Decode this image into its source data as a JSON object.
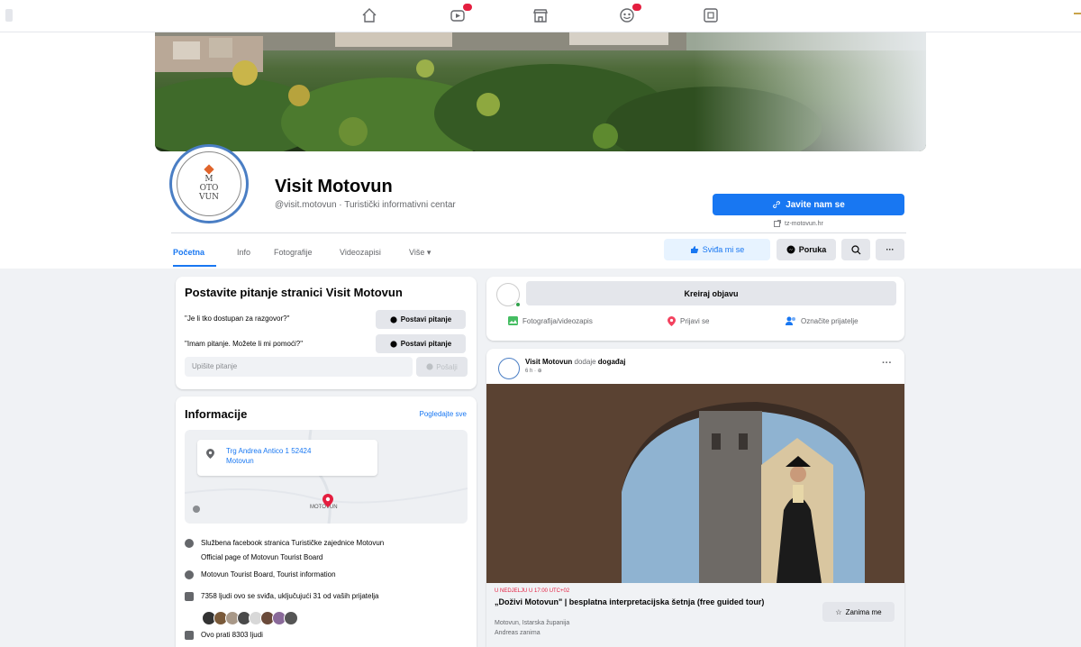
{
  "topnav": {
    "icons": [
      "home-icon",
      "watch-icon",
      "marketplace-icon",
      "groups-icon",
      "gaming-icon"
    ]
  },
  "page": {
    "name": "Visit Motovun",
    "handle": "@visit.motovun · Turistički informativni centar",
    "avatar_text_top": "M",
    "avatar_text_mid": "OTO",
    "avatar_text_bot": "VUN",
    "contact_button": "Javite nam se",
    "website": "tz-motovun.hr"
  },
  "tabs": [
    {
      "label": "Početna"
    },
    {
      "label": "Info"
    },
    {
      "label": "Fotografije"
    },
    {
      "label": "Videozapisi"
    },
    {
      "label": "Više ▾"
    }
  ],
  "actions": {
    "like": "Sviđa mi se",
    "message": "Poruka",
    "more": "···"
  },
  "ask_card": {
    "title": "Postavite pitanje stranici Visit Motovun",
    "questions": [
      {
        "text": "\"Je li tko dostupan za razgovor?\"",
        "button": "Postavi pitanje"
      },
      {
        "text": "\"Imam pitanje. Možete li mi pomoći?\"",
        "button": "Postavi pitanje"
      }
    ],
    "input_placeholder": "Upišite pitanje",
    "send_label": "Pošalji"
  },
  "info_card": {
    "title": "Informacije",
    "see_all": "Pogledajte sve",
    "address_line1": "Trg Andrea Antico 1 52424",
    "address_line2": "Motovun",
    "map_town": "MOTOVUN",
    "desc_line1": "Službena facebook stranica Turističke zajednice Motovun",
    "desc_line2": "Official page of Motovun Tourist Board",
    "category": "Motovun Tourist Board, Tourist information",
    "likes": "7358 ljudi ovo se sviđa, uključujući 31 od vaših prijatelja",
    "follows": "Ovo prati 8303 ljudi"
  },
  "create_card": {
    "create_label": "Kreiraj objavu",
    "photo_label": "Fotografija/videozapis",
    "checkin_label": "Prijavi se",
    "tag_label": "Označite prijatelje"
  },
  "post": {
    "author": "Visit Motovun",
    "verb": "dodaje",
    "object": "događaj",
    "time": "6 h · ⊕",
    "event_date": "U NEDJELJU U 17:00 UTC+02",
    "event_title": "„Doživi Motovun\" | besplatna interpretacijska šetnja (free guided tour)",
    "event_location": "Motovun, Istarska županija",
    "event_interested": "Andreas zanima",
    "interest_button": "Zanima me"
  },
  "colors": {
    "brand": "#1877f2",
    "background": "#f0f2f5",
    "alert": "#e41e3f"
  }
}
